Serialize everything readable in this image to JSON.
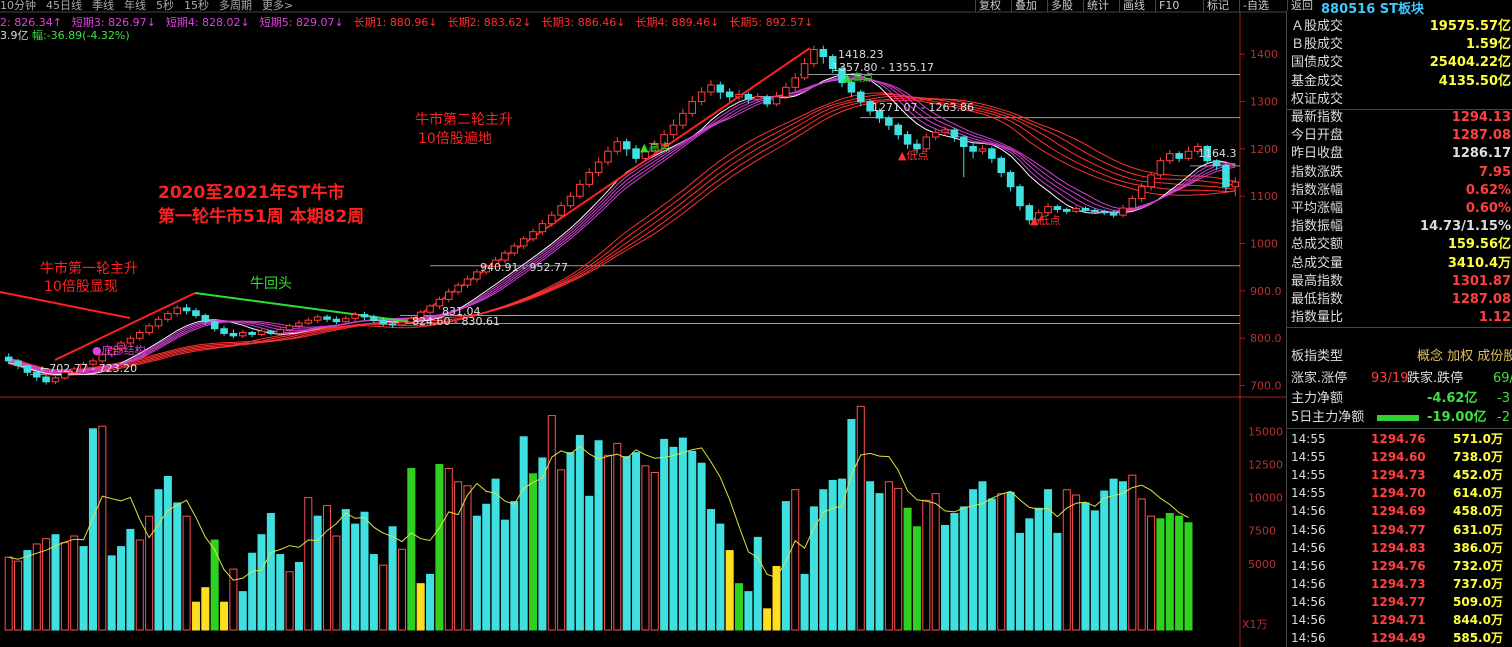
{
  "header": {
    "periods": [
      "10分钟",
      "45日线",
      "季线",
      "年线",
      "5秒",
      "15秒",
      "多周期",
      "更多>"
    ],
    "tools": [
      "复权",
      "叠加",
      "多股",
      "统计",
      "画线",
      "F10",
      "标记",
      "-自选",
      "返回"
    ],
    "code_title": "880516 ST板块"
  },
  "ma_legend": [
    {
      "text": "2: 826.34↑",
      "color": "#e040e0"
    },
    {
      "text": "短期3: 826.97↓",
      "color": "#e040e0"
    },
    {
      "text": "短期4: 828.02↓",
      "color": "#e040e0"
    },
    {
      "text": "短期5: 829.07↓",
      "color": "#e040e0"
    },
    {
      "text": "长期1: 880.96↓",
      "color": "#ff3030"
    },
    {
      "text": "长期2: 883.62↓",
      "color": "#ff3030"
    },
    {
      "text": "长期3: 886.46↓",
      "color": "#ff3030"
    },
    {
      "text": "长期4: 889.46↓",
      "color": "#ff3030"
    },
    {
      "text": "长期5: 892.57↓",
      "color": "#ff3030"
    }
  ],
  "sub_line": {
    "amount": "3.9亿",
    "change": "幅:-36.89(-4.32%)"
  },
  "annotations": {
    "title1": "2020至2021年ST牛市",
    "title2": "第一轮牛市51周  本期82周",
    "bull1a": "牛市第一轮主升",
    "bull1b": "10倍股显现",
    "bull2a": "牛市第二轮主升",
    "bull2b": "10倍股遍地",
    "pullback": "牛回头",
    "lvl_1418": "1418.23",
    "lvl_1357": "1357.80 - 1355.17",
    "lvl_1271": "1271.07 - 1263.86",
    "lvl_1164": "1164.3",
    "lvl_940": "940.91 - 952.77",
    "lvl_831": "831.04",
    "lvl_824": "824.60 - 830.61",
    "lvl_702": "←702.77 - 723.20",
    "high_mark": "▲高点",
    "low_mark": "▲低点",
    "low_mark2": "▲低点",
    "high_mark2": "▲高点",
    "bottom_struct": "●底部结构",
    "unit": "X1万"
  },
  "price_axis": [
    "1400",
    "1300",
    "1200",
    "1100",
    "1000",
    "900.0",
    "800.0",
    "700.0"
  ],
  "volume_axis": [
    "15000",
    "12500",
    "10000",
    "7500",
    "5000"
  ],
  "panel": {
    "rows": [
      {
        "label": "Ａ股成交",
        "value": "19575.57亿",
        "color": "#ffff40"
      },
      {
        "label": "Ｂ股成交",
        "value": "1.59亿",
        "color": "#ffff40"
      },
      {
        "label": "国债成交",
        "value": "25404.22亿",
        "color": "#ffff40"
      },
      {
        "label": "基金成交",
        "value": "4135.50亿",
        "color": "#ffff40"
      },
      {
        "label": "权证成交",
        "value": "",
        "color": "#ffff40"
      },
      {
        "label": "最新指数",
        "value": "1294.13",
        "color": "#ff4040"
      },
      {
        "label": "今日开盘",
        "value": "1287.08",
        "color": "#ff4040"
      },
      {
        "label": "昨日收盘",
        "value": "1286.17",
        "color": "#dddddd"
      },
      {
        "label": "指数涨跌",
        "value": "7.95",
        "color": "#ff4040"
      },
      {
        "label": "指数涨幅",
        "value": "0.62%",
        "color": "#ff4040"
      },
      {
        "label": "平均涨幅",
        "value": "0.60%",
        "color": "#ff4040"
      },
      {
        "label": "指数振幅",
        "value": "14.73/1.15%",
        "color": "#dddddd"
      },
      {
        "label": "总成交额",
        "value": "159.56亿",
        "color": "#ffff40"
      },
      {
        "label": "总成交量",
        "value": "3410.4万",
        "color": "#ffff40"
      },
      {
        "label": "最高指数",
        "value": "1301.87",
        "color": "#ff4040"
      },
      {
        "label": "最低指数",
        "value": "1287.08",
        "color": "#ff4040"
      },
      {
        "label": "指数量比",
        "value": "1.12",
        "color": "#ff4040"
      }
    ],
    "type_label": "板指类型",
    "type_value": "概念 加权 成份股",
    "updown": {
      "l1": "涨家.涨停",
      "v1": "93/19",
      "l2": "跌家.跌停",
      "v2": "69/"
    },
    "flow1": {
      "label": "主力净额",
      "value": "-4.62亿",
      "extra": "-3"
    },
    "flow2": {
      "label": "5日主力净额",
      "value": "-19.00亿",
      "extra": "-2"
    },
    "ticks": [
      {
        "t": "14:55",
        "p": "1294.76",
        "v": "571.0万"
      },
      {
        "t": "14:55",
        "p": "1294.60",
        "v": "738.0万"
      },
      {
        "t": "14:55",
        "p": "1294.73",
        "v": "452.0万"
      },
      {
        "t": "14:55",
        "p": "1294.70",
        "v": "614.0万"
      },
      {
        "t": "14:56",
        "p": "1294.69",
        "v": "458.0万"
      },
      {
        "t": "14:56",
        "p": "1294.77",
        "v": "631.0万"
      },
      {
        "t": "14:56",
        "p": "1294.83",
        "v": "386.0万"
      },
      {
        "t": "14:56",
        "p": "1294.76",
        "v": "732.0万"
      },
      {
        "t": "14:56",
        "p": "1294.73",
        "v": "737.0万"
      },
      {
        "t": "14:56",
        "p": "1294.77",
        "v": "509.0万"
      },
      {
        "t": "14:56",
        "p": "1294.71",
        "v": "844.0万"
      },
      {
        "t": "14:56",
        "p": "1294.49",
        "v": "585.0万"
      }
    ]
  },
  "chart_data": {
    "type": "candlestick",
    "price_range": [
      680,
      1430
    ],
    "volume_range": [
      0,
      17000
    ],
    "candles": [
      [
        760,
        752,
        768,
        745
      ],
      [
        752,
        742,
        756,
        735
      ],
      [
        742,
        728,
        745,
        720
      ],
      [
        728,
        718,
        732,
        710
      ],
      [
        718,
        708,
        722,
        702
      ],
      [
        708,
        716,
        720,
        703
      ],
      [
        716,
        728,
        732,
        712
      ],
      [
        728,
        735,
        740,
        724
      ],
      [
        735,
        745,
        750,
        730
      ],
      [
        745,
        752,
        758,
        740
      ],
      [
        752,
        765,
        770,
        748
      ],
      [
        765,
        778,
        782,
        760
      ],
      [
        778,
        790,
        795,
        772
      ],
      [
        790,
        800,
        806,
        785
      ],
      [
        800,
        812,
        818,
        795
      ],
      [
        812,
        826,
        832,
        806
      ],
      [
        826,
        840,
        846,
        820
      ],
      [
        840,
        852,
        858,
        834
      ],
      [
        852,
        864,
        870,
        846
      ],
      [
        864,
        858,
        872,
        850
      ],
      [
        858,
        848,
        864,
        842
      ],
      [
        848,
        835,
        852,
        828
      ],
      [
        835,
        820,
        840,
        814
      ],
      [
        820,
        810,
        826,
        805
      ],
      [
        810,
        805,
        818,
        800
      ],
      [
        805,
        812,
        818,
        800
      ],
      [
        812,
        808,
        816,
        802
      ],
      [
        808,
        815,
        820,
        804
      ],
      [
        815,
        810,
        818,
        806
      ],
      [
        810,
        818,
        824,
        806
      ],
      [
        818,
        826,
        830,
        812
      ],
      [
        826,
        832,
        838,
        820
      ],
      [
        832,
        838,
        844,
        828
      ],
      [
        838,
        845,
        850,
        832
      ],
      [
        845,
        840,
        850,
        834
      ],
      [
        840,
        835,
        846,
        830
      ],
      [
        835,
        842,
        848,
        830
      ],
      [
        842,
        850,
        856,
        836
      ],
      [
        850,
        845,
        856,
        838
      ],
      [
        845,
        838,
        850,
        832
      ],
      [
        838,
        830,
        844,
        825
      ],
      [
        830,
        828,
        836,
        822
      ],
      [
        828,
        834,
        840,
        824
      ],
      [
        834,
        842,
        848,
        830
      ],
      [
        842,
        855,
        860,
        838
      ],
      [
        855,
        868,
        872,
        850
      ],
      [
        868,
        882,
        888,
        862
      ],
      [
        882,
        898,
        905,
        876
      ],
      [
        898,
        912,
        918,
        892
      ],
      [
        912,
        925,
        932,
        906
      ],
      [
        925,
        940,
        946,
        918
      ],
      [
        940,
        952,
        958,
        934
      ],
      [
        952,
        965,
        972,
        946
      ],
      [
        965,
        980,
        986,
        958
      ],
      [
        980,
        995,
        1002,
        974
      ],
      [
        995,
        1010,
        1016,
        988
      ],
      [
        1010,
        1025,
        1032,
        1004
      ],
      [
        1025,
        1042,
        1050,
        1018
      ],
      [
        1042,
        1060,
        1068,
        1036
      ],
      [
        1060,
        1080,
        1088,
        1054
      ],
      [
        1080,
        1100,
        1108,
        1074
      ],
      [
        1100,
        1125,
        1135,
        1094
      ],
      [
        1125,
        1150,
        1160,
        1118
      ],
      [
        1150,
        1172,
        1182,
        1142
      ],
      [
        1172,
        1195,
        1205,
        1165
      ],
      [
        1195,
        1215,
        1225,
        1188
      ],
      [
        1215,
        1200,
        1222,
        1185
      ],
      [
        1200,
        1180,
        1208,
        1170
      ],
      [
        1180,
        1195,
        1205,
        1172
      ],
      [
        1195,
        1210,
        1218,
        1186
      ],
      [
        1210,
        1230,
        1240,
        1202
      ],
      [
        1230,
        1250,
        1262,
        1222
      ],
      [
        1250,
        1275,
        1285,
        1242
      ],
      [
        1275,
        1300,
        1312,
        1268
      ],
      [
        1300,
        1320,
        1330,
        1292
      ],
      [
        1320,
        1335,
        1345,
        1312
      ],
      [
        1335,
        1320,
        1342,
        1305
      ],
      [
        1320,
        1310,
        1328,
        1300
      ],
      [
        1310,
        1315,
        1325,
        1302
      ],
      [
        1315,
        1305,
        1320,
        1296
      ],
      [
        1305,
        1310,
        1318,
        1298
      ],
      [
        1310,
        1295,
        1315,
        1288
      ],
      [
        1295,
        1310,
        1320,
        1290
      ],
      [
        1310,
        1330,
        1340,
        1305
      ],
      [
        1330,
        1350,
        1360,
        1322
      ],
      [
        1350,
        1380,
        1392,
        1345
      ],
      [
        1380,
        1410,
        1418,
        1372
      ],
      [
        1410,
        1395,
        1418,
        1380
      ],
      [
        1395,
        1370,
        1400,
        1360
      ],
      [
        1370,
        1340,
        1375,
        1330
      ],
      [
        1340,
        1320,
        1345,
        1310
      ],
      [
        1320,
        1300,
        1325,
        1290
      ],
      [
        1300,
        1280,
        1305,
        1270
      ],
      [
        1280,
        1265,
        1285,
        1255
      ],
      [
        1265,
        1250,
        1270,
        1240
      ],
      [
        1250,
        1230,
        1255,
        1220
      ],
      [
        1230,
        1210,
        1238,
        1200
      ],
      [
        1210,
        1200,
        1220,
        1190
      ],
      [
        1200,
        1225,
        1232,
        1195
      ],
      [
        1225,
        1235,
        1242,
        1218
      ],
      [
        1235,
        1240,
        1248,
        1228
      ],
      [
        1240,
        1225,
        1245,
        1215
      ],
      [
        1225,
        1205,
        1228,
        1140
      ],
      [
        1205,
        1195,
        1212,
        1180
      ],
      [
        1195,
        1200,
        1208,
        1188
      ],
      [
        1200,
        1180,
        1205,
        1170
      ],
      [
        1180,
        1150,
        1185,
        1140
      ],
      [
        1150,
        1120,
        1155,
        1110
      ],
      [
        1120,
        1080,
        1125,
        1070
      ],
      [
        1080,
        1050,
        1085,
        1040
      ],
      [
        1050,
        1065,
        1072,
        1042
      ],
      [
        1065,
        1078,
        1085,
        1058
      ],
      [
        1078,
        1072,
        1082,
        1065
      ],
      [
        1072,
        1068,
        1076,
        1062
      ],
      [
        1068,
        1074,
        1080,
        1064
      ],
      [
        1074,
        1070,
        1078,
        1065
      ],
      [
        1070,
        1068,
        1075,
        1062
      ],
      [
        1068,
        1065,
        1072,
        1060
      ],
      [
        1065,
        1060,
        1070,
        1055
      ],
      [
        1060,
        1075,
        1082,
        1055
      ],
      [
        1075,
        1095,
        1102,
        1070
      ],
      [
        1095,
        1120,
        1128,
        1088
      ],
      [
        1120,
        1145,
        1152,
        1112
      ],
      [
        1145,
        1175,
        1182,
        1138
      ],
      [
        1175,
        1190,
        1198,
        1168
      ],
      [
        1190,
        1180,
        1195,
        1172
      ],
      [
        1180,
        1195,
        1205,
        1175
      ],
      [
        1195,
        1205,
        1212,
        1188
      ],
      [
        1205,
        1175,
        1208,
        1168
      ],
      [
        1175,
        1165,
        1178,
        1155
      ],
      [
        1165,
        1120,
        1170,
        1110
      ],
      [
        1120,
        1130,
        1140,
        1100
      ]
    ],
    "volumes": [
      [
        5500,
        1
      ],
      [
        5200,
        1
      ],
      [
        6000,
        0
      ],
      [
        6500,
        1
      ],
      [
        6900,
        1
      ],
      [
        7200,
        0
      ],
      [
        6600,
        1
      ],
      [
        7100,
        1
      ],
      [
        6300,
        0
      ],
      [
        15200,
        0
      ],
      [
        15400,
        1
      ],
      [
        5600,
        0
      ],
      [
        6300,
        0
      ],
      [
        7600,
        0
      ],
      [
        6800,
        1
      ],
      [
        8600,
        1
      ],
      [
        10600,
        0
      ],
      [
        11600,
        0
      ],
      [
        9600,
        0
      ],
      [
        8600,
        1
      ],
      [
        2100,
        3
      ],
      [
        3200,
        3
      ],
      [
        6800,
        2
      ],
      [
        2100,
        3
      ],
      [
        4600,
        1
      ],
      [
        2900,
        0
      ],
      [
        5800,
        0
      ],
      [
        7200,
        0
      ],
      [
        8800,
        0
      ],
      [
        5700,
        0
      ],
      [
        4400,
        1
      ],
      [
        5100,
        0
      ],
      [
        10000,
        1
      ],
      [
        8600,
        0
      ],
      [
        9400,
        1
      ],
      [
        7100,
        1
      ],
      [
        9100,
        0
      ],
      [
        8000,
        0
      ],
      [
        8900,
        0
      ],
      [
        5700,
        0
      ],
      [
        4900,
        1
      ],
      [
        7800,
        0
      ],
      [
        6100,
        1
      ],
      [
        12200,
        2
      ],
      [
        3500,
        3
      ],
      [
        4200,
        0
      ],
      [
        12500,
        2
      ],
      [
        12200,
        1
      ],
      [
        11200,
        1
      ],
      [
        10900,
        1
      ],
      [
        8600,
        0
      ],
      [
        9500,
        0
      ],
      [
        11400,
        0
      ],
      [
        8300,
        0
      ],
      [
        9700,
        0
      ],
      [
        14600,
        0
      ],
      [
        11800,
        2
      ],
      [
        13000,
        0
      ],
      [
        16200,
        1
      ],
      [
        12100,
        1
      ],
      [
        13400,
        0
      ],
      [
        14700,
        0
      ],
      [
        10100,
        0
      ],
      [
        14300,
        0
      ],
      [
        13200,
        1
      ],
      [
        14100,
        1
      ],
      [
        13100,
        0
      ],
      [
        13400,
        0
      ],
      [
        12400,
        1
      ],
      [
        11900,
        1
      ],
      [
        14400,
        0
      ],
      [
        13800,
        0
      ],
      [
        14500,
        0
      ],
      [
        13500,
        0
      ],
      [
        12600,
        0
      ],
      [
        9100,
        0
      ],
      [
        8000,
        0
      ],
      [
        6000,
        3
      ],
      [
        3500,
        2
      ],
      [
        2900,
        0
      ],
      [
        7000,
        0
      ],
      [
        1600,
        3
      ],
      [
        4800,
        3
      ],
      [
        9700,
        0
      ],
      [
        10600,
        1
      ],
      [
        4200,
        0
      ],
      [
        9300,
        0
      ],
      [
        10600,
        0
      ],
      [
        11300,
        0
      ],
      [
        11400,
        0
      ],
      [
        15900,
        0
      ],
      [
        16900,
        1
      ],
      [
        11200,
        0
      ],
      [
        10300,
        0
      ],
      [
        11200,
        1
      ],
      [
        10700,
        1
      ],
      [
        9200,
        2
      ],
      [
        7800,
        2
      ],
      [
        9800,
        1
      ],
      [
        10300,
        1
      ],
      [
        7900,
        0
      ],
      [
        8800,
        0
      ],
      [
        9300,
        0
      ],
      [
        10600,
        0
      ],
      [
        11200,
        0
      ],
      [
        9900,
        0
      ],
      [
        10300,
        1
      ],
      [
        10400,
        0
      ],
      [
        7300,
        0
      ],
      [
        8400,
        0
      ],
      [
        9200,
        0
      ],
      [
        10600,
        0
      ],
      [
        7300,
        0
      ],
      [
        10600,
        1
      ],
      [
        10200,
        1
      ],
      [
        9600,
        0
      ],
      [
        9000,
        0
      ],
      [
        10500,
        0
      ],
      [
        11400,
        0
      ],
      [
        11200,
        0
      ],
      [
        11700,
        1
      ],
      [
        9900,
        1
      ],
      [
        8600,
        1
      ],
      [
        8400,
        2
      ],
      [
        8800,
        2
      ],
      [
        8600,
        2
      ],
      [
        8100,
        2
      ]
    ],
    "key_levels": [
      1418.23,
      1357.8,
      1355.17,
      1271.07,
      1263.86,
      1164.3,
      940.91,
      952.77,
      831.04,
      824.6,
      830.61,
      702.77,
      723.2
    ]
  }
}
